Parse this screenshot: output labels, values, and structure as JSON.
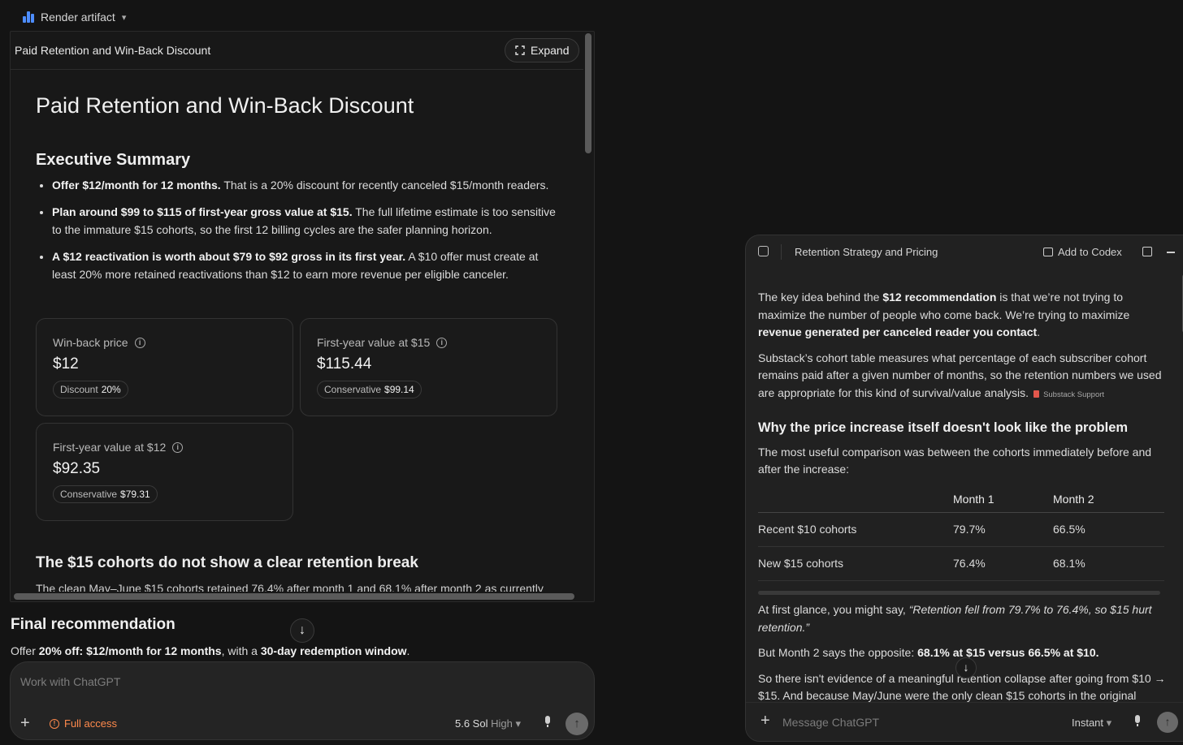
{
  "top_bar": {
    "label": "Render artifact",
    "chevron": "▾"
  },
  "artifact": {
    "header_title": "Paid Retention and Win-Back Discount",
    "expand_label": "Expand",
    "doc_title": "Paid Retention and Win-Back Discount",
    "exec_heading": "Executive Summary",
    "summary": [
      {
        "bold": "Offer $12/month for 12 months.",
        "text": " That is a 20% discount for recently canceled $15/month readers."
      },
      {
        "bold": "Plan around $99 to $115 of first-year gross value at $15.",
        "text": " The full lifetime estimate is too sensitive to the immature $15 cohorts, so the first 12 billing cycles are the safer planning horizon."
      },
      {
        "bold": "A $12 reactivation is worth about $79 to $92 gross in its first year.",
        "text": " A $10 offer must create at least 20% more retained reactivations than $12 to earn more revenue per eligible canceler."
      }
    ],
    "cards": [
      {
        "label": "Win-back price",
        "value": "$12",
        "badge_label": "Discount",
        "badge_value": "20%"
      },
      {
        "label": "First-year value at $15",
        "value": "$115.44",
        "badge_label": "Conservative",
        "badge_value": "$99.14"
      },
      {
        "label": "First-year value at $12",
        "value": "$92.35",
        "badge_label": "Conservative",
        "badge_value": "$79.31"
      }
    ],
    "clean_heading": "The $15 cohorts do not show a clear retention break",
    "clean_text": "The clean May–June $15 cohorts retained 76.4% after month 1 and 68.1% after month 2 as currently"
  },
  "final": {
    "heading": "Final recommendation",
    "text_1": "Offer ",
    "bold_1": "20% off: $12/month for 12 months",
    "text_2": ", with a ",
    "bold_2": "30-day redemption window",
    "text_3": "."
  },
  "composer_left": {
    "placeholder": "Work with ChatGPT",
    "plus": "+",
    "access_label": "Full access",
    "model": "5.6 Sol",
    "effort": "High",
    "send": "↑"
  },
  "chat": {
    "title": "Retention Strategy and Pricing",
    "add_to_codex": "Add to Codex",
    "p1_a": "The key idea behind the ",
    "p1_b": "$12 recommendation",
    "p1_c": " is that we’re not trying to maximize the number of people who come back. We’re trying to maximize ",
    "p1_d": "revenue generated per canceled reader you contact",
    "p1_e": ".",
    "p2": "Substack’s cohort table measures what percentage of each subscriber cohort remains paid after a given number of months, so the retention numbers we used are appropriate for this kind of survival/value analysis.",
    "source_chip": "Substack Support",
    "why_heading": "Why the price increase itself doesn't look like the problem",
    "p3": "The most useful comparison was between the cohorts immediately before and after the increase:",
    "table": {
      "headers": [
        "",
        "Month 1",
        "Month 2"
      ],
      "rows": [
        [
          "Recent $10 cohorts",
          "79.7%",
          "66.5%"
        ],
        [
          "New $15 cohorts",
          "76.4%",
          "68.1%"
        ]
      ]
    },
    "p4_a": "At first glance, you might say, ",
    "p4_b": "“Retention fell from 79.7% to 76.4%, so $15 hurt retention.”",
    "p5_a": "But Month 2 says the opposite: ",
    "p5_b": "68.1% at $15 versus 66.5% at $10.",
    "p6": "So there isn't evidence of a meaningful retention collapse after going from $10 → $15. And because May/June were the only clean $15 cohorts in the original",
    "composer_placeholder": "Message ChatGPT",
    "plus": "+",
    "mode": "Instant",
    "send": "↑",
    "scroll_down": "↓"
  },
  "colors": {
    "accent_warning": "#ff8a4c",
    "logo_blue": "#4d8dff",
    "source_red": "#e2574c"
  }
}
